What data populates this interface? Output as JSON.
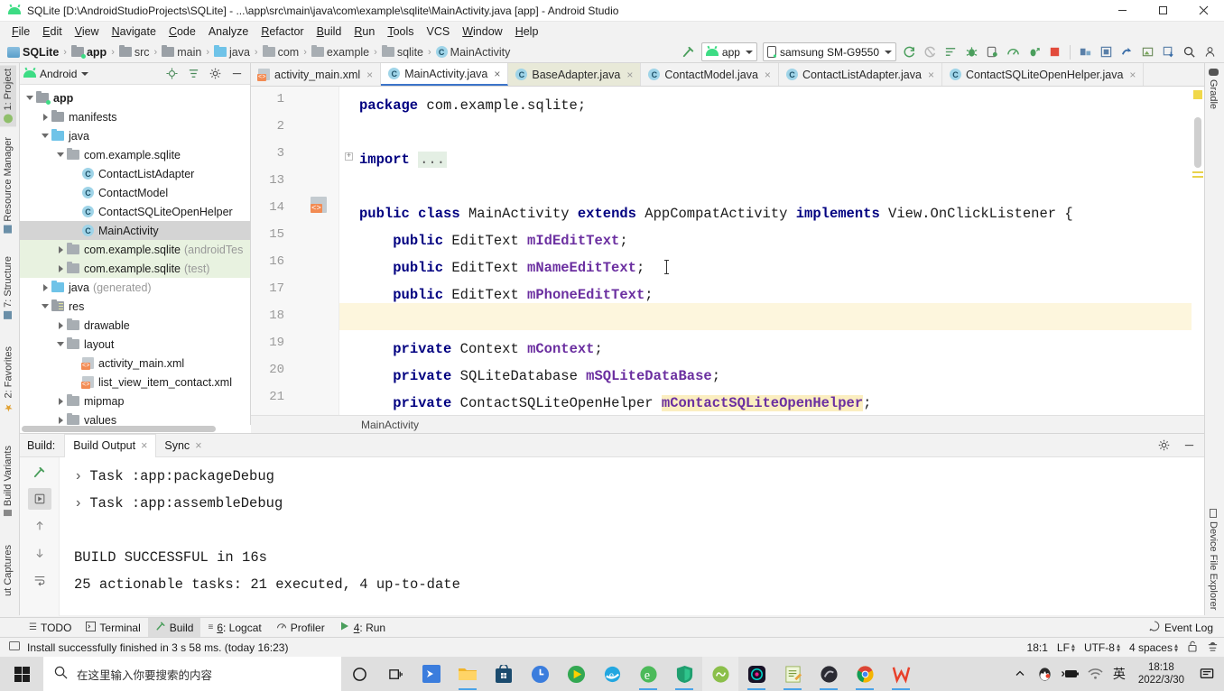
{
  "window": {
    "title": "SQLite [D:\\AndroidStudioProjects\\SQLite] - ...\\app\\src\\main\\java\\com\\example\\sqlite\\MainActivity.java [app] - Android Studio",
    "app_icon": "android-icon",
    "controls": {
      "minimize": "minimize-icon",
      "maximize": "maximize-icon",
      "close": "close-icon"
    }
  },
  "menubar": {
    "items": [
      {
        "label": "File"
      },
      {
        "label": "Edit"
      },
      {
        "label": "View"
      },
      {
        "label": "Navigate"
      },
      {
        "label": "Code"
      },
      {
        "label": "Analyze"
      },
      {
        "label": "Refactor"
      },
      {
        "label": "Build"
      },
      {
        "label": "Run"
      },
      {
        "label": "Tools"
      },
      {
        "label": "VCS"
      },
      {
        "label": "Window"
      },
      {
        "label": "Help"
      }
    ]
  },
  "navbar": {
    "breadcrumbs": [
      {
        "label": "SQLite",
        "icon": "sqlite-project-icon",
        "bold": true
      },
      {
        "label": "app",
        "icon": "module-folder-icon",
        "bold": true
      },
      {
        "label": "src",
        "icon": "folder-icon",
        "bold": false
      },
      {
        "label": "main",
        "icon": "folder-icon",
        "bold": false
      },
      {
        "label": "java",
        "icon": "java-folder-icon",
        "bold": false
      },
      {
        "label": "com",
        "icon": "package-icon",
        "bold": false
      },
      {
        "label": "example",
        "icon": "package-icon",
        "bold": false
      },
      {
        "label": "sqlite",
        "icon": "package-icon",
        "bold": false
      },
      {
        "label": "MainActivity",
        "icon": "class-icon",
        "bold": false
      }
    ],
    "run_config": {
      "label": "app",
      "icon": "android-icon"
    },
    "device": {
      "label": "samsung SM-G9550",
      "icon": "phone-icon"
    },
    "toolbar_icons": [
      "build-hammer-icon",
      "sync-gradle-icon",
      "avd-manager-icon",
      "run-inspection-icon",
      "debug-icon",
      "attach-debugger-icon",
      "profiler-icon",
      "run-with-coverage-icon",
      "stop-icon",
      "sdk-manager-icon",
      "layout-inspector-icon",
      "device-manager-icon",
      "apk-analyzer-icon",
      "download-icon",
      "search-icon",
      "account-icon"
    ]
  },
  "left_tool_strip": {
    "top_tabs": [
      {
        "label": "1: Project",
        "active": true
      },
      {
        "label": "Resource Manager",
        "active": false
      },
      {
        "label": "7: Structure",
        "active": false
      },
      {
        "label": "2: Favorites",
        "active": false
      }
    ],
    "bottom_tabs": [
      {
        "label": "Build Variants"
      },
      {
        "label": "ut Captures"
      }
    ]
  },
  "right_tool_strip": {
    "top_tabs": [
      {
        "label": "Gradle"
      }
    ],
    "bottom_tabs": [
      {
        "label": "Device File Explorer"
      }
    ]
  },
  "project_panel": {
    "header": {
      "title": "Android",
      "icon": "android-icon",
      "dropdown": "chevron-down-icon",
      "actions": [
        "locate-icon",
        "collapse-all-icon",
        "settings-gear-icon",
        "hide-icon"
      ]
    },
    "tree": [
      {
        "indent": 0,
        "arrow": "down",
        "icon": "module-folder-icon",
        "label": "app",
        "bold": true,
        "muted": "",
        "selected": false,
        "green": false
      },
      {
        "indent": 1,
        "arrow": "right",
        "icon": "folder-icon",
        "label": "manifests",
        "bold": false,
        "muted": "",
        "selected": false,
        "green": false
      },
      {
        "indent": 1,
        "arrow": "down",
        "icon": "java-folder-icon",
        "label": "java",
        "bold": false,
        "muted": "",
        "selected": false,
        "green": false
      },
      {
        "indent": 2,
        "arrow": "down",
        "icon": "package-icon",
        "label": "com.example.sqlite",
        "bold": false,
        "muted": "",
        "selected": false,
        "green": false
      },
      {
        "indent": 3,
        "arrow": "none",
        "icon": "class-icon",
        "label": "ContactListAdapter",
        "bold": false,
        "muted": "",
        "selected": false,
        "green": false
      },
      {
        "indent": 3,
        "arrow": "none",
        "icon": "class-icon",
        "label": "ContactModel",
        "bold": false,
        "muted": "",
        "selected": false,
        "green": false
      },
      {
        "indent": 3,
        "arrow": "none",
        "icon": "class-icon",
        "label": "ContactSQLiteOpenHelper",
        "bold": false,
        "muted": "",
        "selected": false,
        "green": false
      },
      {
        "indent": 3,
        "arrow": "none",
        "icon": "class-icon",
        "label": "MainActivity",
        "bold": false,
        "muted": "",
        "selected": true,
        "green": false
      },
      {
        "indent": 2,
        "arrow": "right",
        "icon": "package-icon",
        "label": "com.example.sqlite",
        "bold": false,
        "muted": "(androidTes",
        "selected": false,
        "green": true
      },
      {
        "indent": 2,
        "arrow": "right",
        "icon": "package-icon",
        "label": "com.example.sqlite",
        "bold": false,
        "muted": "(test)",
        "selected": false,
        "green": true
      },
      {
        "indent": 1,
        "arrow": "right",
        "icon": "java-generated-icon",
        "label": "java",
        "bold": false,
        "muted": "(generated)",
        "selected": false,
        "green": false
      },
      {
        "indent": 1,
        "arrow": "down",
        "icon": "res-folder-icon",
        "label": "res",
        "bold": false,
        "muted": "",
        "selected": false,
        "green": false
      },
      {
        "indent": 2,
        "arrow": "right",
        "icon": "package-icon",
        "label": "drawable",
        "bold": false,
        "muted": "",
        "selected": false,
        "green": false
      },
      {
        "indent": 2,
        "arrow": "down",
        "icon": "package-icon",
        "label": "layout",
        "bold": false,
        "muted": "",
        "selected": false,
        "green": false
      },
      {
        "indent": 3,
        "arrow": "none",
        "icon": "xml-file-icon",
        "label": "activity_main.xml",
        "bold": false,
        "muted": "",
        "selected": false,
        "green": false
      },
      {
        "indent": 3,
        "arrow": "none",
        "icon": "xml-file-icon",
        "label": "list_view_item_contact.xml",
        "bold": false,
        "muted": "",
        "selected": false,
        "green": false
      },
      {
        "indent": 2,
        "arrow": "right",
        "icon": "package-icon",
        "label": "mipmap",
        "bold": false,
        "muted": "",
        "selected": false,
        "green": false
      },
      {
        "indent": 2,
        "arrow": "right",
        "icon": "package-icon",
        "label": "values",
        "bold": false,
        "muted": "",
        "selected": false,
        "green": false
      }
    ]
  },
  "editor": {
    "tabs": [
      {
        "label": "activity_main.xml",
        "icon": "xml-file-icon",
        "active": false,
        "highlight": false,
        "close": "×"
      },
      {
        "label": "MainActivity.java",
        "icon": "class-icon",
        "active": true,
        "highlight": false,
        "close": "×"
      },
      {
        "label": "BaseAdapter.java",
        "icon": "class-icon",
        "active": false,
        "highlight": true,
        "close": "×"
      },
      {
        "label": "ContactModel.java",
        "icon": "class-icon",
        "active": false,
        "highlight": false,
        "close": "×"
      },
      {
        "label": "ContactListAdapter.java",
        "icon": "class-icon",
        "active": false,
        "highlight": false,
        "close": "×"
      },
      {
        "label": "ContactSQLiteOpenHelper.java",
        "icon": "class-icon",
        "active": false,
        "highlight": false,
        "close": "×"
      }
    ],
    "lines": [
      {
        "num": "1",
        "html": "<span class=\"kw\">package</span> com.example.sqlite;"
      },
      {
        "num": "2",
        "html": ""
      },
      {
        "num": "3",
        "html": "<span class=\"kw\">import</span> <span class=\"fold-el\">...</span>"
      },
      {
        "num": "13",
        "html": ""
      },
      {
        "num": "14",
        "html": "<span class=\"kw\">public</span> <span class=\"kw\">class</span> MainActivity <span class=\"kw\">extends</span> AppCompatActivity <span class=\"kw\">implements</span> View.OnClickListener {"
      },
      {
        "num": "15",
        "html": "    <span class=\"kw\">public</span> EditText <span class=\"fld\">mIdEditText</span>;"
      },
      {
        "num": "16",
        "html": "    <span class=\"kw\">public</span> EditText <span class=\"fld\">mNameEditText</span>;"
      },
      {
        "num": "17",
        "html": "    <span class=\"kw\">public</span> EditText <span class=\"fld\">mPhoneEditText</span>;"
      },
      {
        "num": "18",
        "html": ""
      },
      {
        "num": "19",
        "html": "    <span class=\"kw\">private</span> Context <span class=\"fld\">mContext</span>;"
      },
      {
        "num": "20",
        "html": "    <span class=\"kw\">private</span> SQLiteDatabase <span class=\"fld\">mSQLiteDataBase</span>;"
      },
      {
        "num": "21",
        "html": "    <span class=\"kw\">private</span> ContactSQLiteOpenHelper <span class=\"fld-hl\">mContactSQLiteOpenHelper</span>;"
      }
    ],
    "highlighted_line_index": 8,
    "breadcrumb": "MainActivity"
  },
  "build_panel": {
    "label": "Build:",
    "tabs": [
      {
        "label": "Build Output",
        "active": true,
        "close": "×"
      },
      {
        "label": "Sync",
        "active": false,
        "close": "×"
      }
    ],
    "actions": [
      "settings-gear-icon",
      "hide-icon"
    ],
    "side_buttons": [
      "build-hammer-icon",
      "restart-icon",
      "up-arrow-icon",
      "down-arrow-icon",
      "soft-wrap-icon"
    ],
    "output": [
      {
        "chevron": "›",
        "text": "Task :app:packageDebug"
      },
      {
        "chevron": "›",
        "text": "Task :app:assembleDebug"
      },
      {
        "chevron": "",
        "text": ""
      },
      {
        "chevron": "",
        "text": "BUILD SUCCESSFUL in 16s"
      },
      {
        "chevron": "",
        "text": "25 actionable tasks: 21 executed, 4 up-to-date"
      }
    ]
  },
  "bottom_tabs": {
    "items": [
      {
        "label": "TODO",
        "icon": "todo-icon",
        "active": false,
        "mnemonic": ""
      },
      {
        "label": "Terminal",
        "icon": "terminal-icon",
        "active": false,
        "mnemonic": ""
      },
      {
        "label": "Build",
        "icon": "build-hammer-icon",
        "active": true,
        "mnemonic": ""
      },
      {
        "label": "6: Logcat",
        "icon": "logcat-icon",
        "active": false,
        "mnemonic": "6"
      },
      {
        "label": "Profiler",
        "icon": "profiler-icon",
        "active": false,
        "mnemonic": ""
      },
      {
        "label": "4: Run",
        "icon": "run-icon",
        "active": false,
        "mnemonic": "4"
      }
    ],
    "event_log": {
      "label": "Event Log",
      "icon": "event-log-icon"
    }
  },
  "statusbar": {
    "message": "Install successfully finished in 3 s 58 ms. (today 16:23)",
    "message_icon": "memory-indicator-icon",
    "caret_position": "18:1",
    "line_separator": "LF",
    "encoding": "UTF-8",
    "indent": "4 spaces",
    "lock_icon": "unlocked-icon",
    "inspection_icon": "hector-icon"
  },
  "taskbar": {
    "start": "windows-logo-icon",
    "search_placeholder": "在这里输入你要搜索的内容",
    "search_icon": "search-icon",
    "buttons": [
      {
        "icon": "cortana-icon",
        "running": false,
        "active": false
      },
      {
        "icon": "task-view-icon",
        "running": false,
        "active": false
      },
      {
        "icon": "app-blue-bird-icon",
        "running": false,
        "active": false
      },
      {
        "icon": "file-explorer-icon",
        "running": true,
        "active": false
      },
      {
        "icon": "microsoft-store-icon",
        "running": false,
        "active": false
      },
      {
        "icon": "clock-app-icon",
        "running": false,
        "active": false
      },
      {
        "icon": "media-player-icon",
        "running": false,
        "active": false
      },
      {
        "icon": "internet-explorer-icon",
        "running": false,
        "active": false
      },
      {
        "icon": "edge-legacy-icon",
        "running": true,
        "active": false
      },
      {
        "icon": "green-shield-icon",
        "running": true,
        "active": false
      },
      {
        "icon": "wechat-dev-icon",
        "running": false,
        "active": true
      },
      {
        "icon": "nox-player-icon",
        "running": true,
        "active": false
      },
      {
        "icon": "notepad-icon",
        "running": true,
        "active": false
      },
      {
        "icon": "dark-app-icon",
        "running": true,
        "active": false
      },
      {
        "icon": "chrome-icon",
        "running": true,
        "active": false
      },
      {
        "icon": "wps-icon",
        "running": true,
        "active": false
      }
    ],
    "tray": {
      "chevron": "show-hidden-icons-icon",
      "icons": [
        "qq-icon",
        "battery-icon",
        "wifi-icon"
      ],
      "ime": "英",
      "time": "18:18",
      "date": "2022/3/30",
      "notifications": "notification-center-icon"
    }
  },
  "colors": {
    "accent": "#3c74c9",
    "android_green": "#3ddc84",
    "keyword": "#000080",
    "field": "#6b2fa0",
    "highlight_row": "#fdf6dd",
    "selection": "#d4d4d4",
    "test_source": "#e8f2e0"
  }
}
